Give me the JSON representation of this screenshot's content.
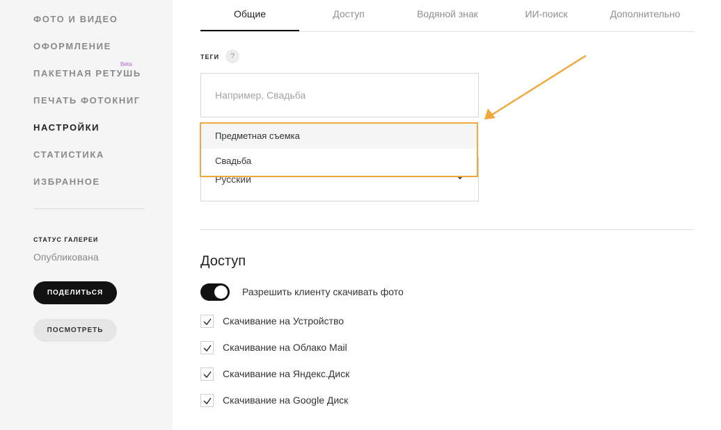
{
  "sidebar": {
    "nav": [
      {
        "label": "ФОТО И ВИДЕО"
      },
      {
        "label": "ОФОРМЛЕНИЕ"
      },
      {
        "label": "ПАКЕТНАЯ РЕТУШЬ"
      },
      {
        "label": "ПЕЧАТЬ ФОТОКНИГ"
      },
      {
        "label": "НАСТРОЙКИ"
      },
      {
        "label": "СТАТИСТИКА"
      },
      {
        "label": "ИЗБРАННОЕ"
      }
    ],
    "beta_badge": "Beta",
    "active_item": "НАСТРОЙКИ",
    "status_title": "СТАТУС ГАЛЕРЕИ",
    "status_value": "Опубликована",
    "share_button": "ПОДЕЛИТЬСЯ",
    "view_button": "ПОСМОТРЕТЬ"
  },
  "tabs": [
    {
      "label": "Общие"
    },
    {
      "label": "Доступ"
    },
    {
      "label": "Водяной знак"
    },
    {
      "label": "ИИ-поиск"
    },
    {
      "label": "Дополнительно"
    }
  ],
  "active_tab": "Общие",
  "tags": {
    "label": "ТЕГИ",
    "help_icon": "?",
    "input_value": "",
    "placeholder": "Например, Свадьба",
    "suggestions": [
      "Предметная съемка",
      "Свадьба"
    ]
  },
  "language_select": {
    "value": "Русский"
  },
  "access": {
    "title": "Доступ",
    "toggle_label": "Разрешить клиенту скачивать фото",
    "toggle_on": true,
    "options": [
      {
        "label": "Скачивание на Устройство",
        "checked": true
      },
      {
        "label": "Скачивание на Облако Mail",
        "checked": true
      },
      {
        "label": "Скачивание на Яндекс.Диск",
        "checked": true
      },
      {
        "label": "Скачивание на Google Диск",
        "checked": true
      }
    ]
  },
  "colors": {
    "highlight": "#f0a73c",
    "beta": "#b55cd6",
    "primary": "#111111"
  }
}
